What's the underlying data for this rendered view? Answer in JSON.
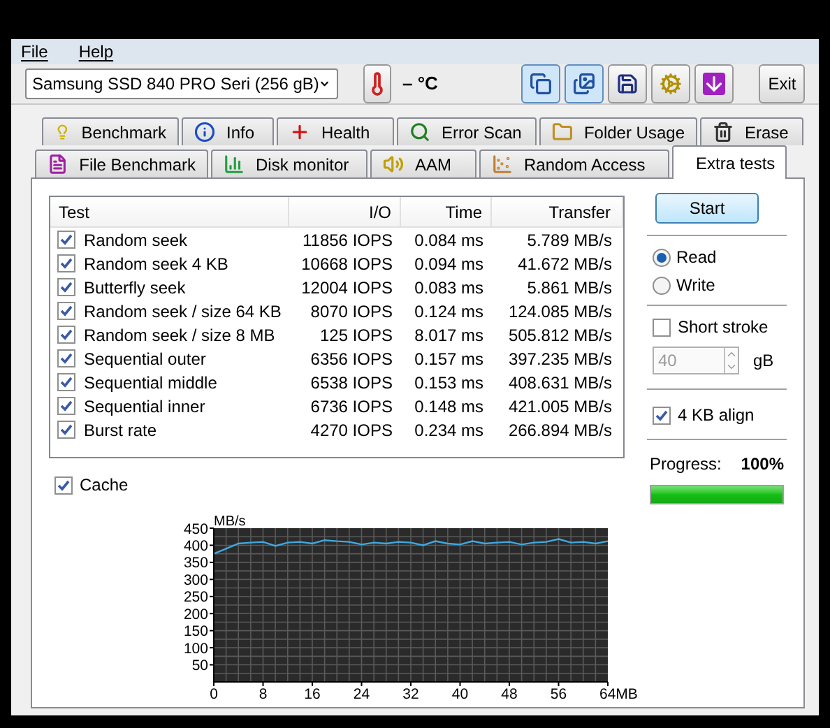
{
  "menu": [
    {
      "label": "File"
    },
    {
      "label": "Help"
    }
  ],
  "toolbar": {
    "drive": "Samsung SSD 840 PRO Seri (256 gB)",
    "temperature": "– °C",
    "tools": [
      {
        "pressed": true
      },
      {
        "pressed": true
      },
      {
        "pressed": false
      },
      {
        "pressed": false
      },
      {
        "pressed": false
      }
    ],
    "exit": "Exit"
  },
  "tabs_row_1": [
    {
      "label": "Benchmark",
      "selected": false
    },
    {
      "label": "Info",
      "selected": false
    },
    {
      "label": "Health",
      "selected": false
    },
    {
      "label": "Error Scan",
      "selected": false
    },
    {
      "label": "Folder Usage",
      "selected": false
    },
    {
      "label": "Erase",
      "selected": false
    }
  ],
  "tabs_row_2": [
    {
      "label": "File Benchmark",
      "selected": false
    },
    {
      "label": "Disk monitor",
      "selected": false
    },
    {
      "label": "AAM",
      "selected": false
    },
    {
      "label": "Random Access",
      "selected": false
    },
    {
      "label": "Extra tests",
      "selected": true
    }
  ],
  "table": {
    "columns": [
      "Test",
      "I/O",
      "Time",
      "Transfer"
    ],
    "rows": [
      {
        "checked": true,
        "test": "Random seek",
        "io": "11856 IOPS",
        "time": "0.084 ms",
        "transfer": "5.789 MB/s"
      },
      {
        "checked": true,
        "test": "Random seek 4 KB",
        "io": "10668 IOPS",
        "time": "0.094 ms",
        "transfer": "41.672 MB/s"
      },
      {
        "checked": true,
        "test": "Butterfly seek",
        "io": "12004 IOPS",
        "time": "0.083 ms",
        "transfer": "5.861 MB/s"
      },
      {
        "checked": true,
        "test": "Random seek / size 64 KB",
        "io": "8070 IOPS",
        "time": "0.124 ms",
        "transfer": "124.085 MB/s"
      },
      {
        "checked": true,
        "test": "Random seek / size 8 MB",
        "io": "125 IOPS",
        "time": "8.017 ms",
        "transfer": "505.812 MB/s"
      },
      {
        "checked": true,
        "test": "Sequential outer",
        "io": "6356 IOPS",
        "time": "0.157 ms",
        "transfer": "397.235 MB/s"
      },
      {
        "checked": true,
        "test": "Sequential middle",
        "io": "6538 IOPS",
        "time": "0.153 ms",
        "transfer": "408.631 MB/s"
      },
      {
        "checked": true,
        "test": "Sequential inner",
        "io": "6736 IOPS",
        "time": "0.148 ms",
        "transfer": "421.005 MB/s"
      },
      {
        "checked": true,
        "test": "Burst rate",
        "io": "4270 IOPS",
        "time": "0.234 ms",
        "transfer": "266.894 MB/s"
      }
    ]
  },
  "cache": {
    "label": "Cache",
    "checked": true
  },
  "side": {
    "start": "Start",
    "modes": [
      {
        "label": "Read",
        "selected": true
      },
      {
        "label": "Write",
        "selected": false
      }
    ],
    "short_stroke": {
      "label": "Short stroke",
      "checked": false
    },
    "size": {
      "value": "40",
      "disabled": true,
      "unit": "gB"
    },
    "align": {
      "label": "4 KB align",
      "checked": true
    },
    "progress": {
      "label": "Progress:",
      "reading": "100%",
      "level": 1
    }
  },
  "chart_data": {
    "type": "line",
    "grid": true,
    "ylabel": "MB/s",
    "xlim": [
      0,
      64
    ],
    "ylim": [
      0,
      450
    ],
    "xticks": [
      0,
      8,
      16,
      24,
      32,
      40,
      48,
      56,
      {
        "value": 64,
        "label": "64MB"
      }
    ],
    "yticks": [
      50,
      100,
      150,
      200,
      250,
      300,
      350,
      400,
      450
    ],
    "x": [
      0,
      2,
      4,
      6,
      8,
      10,
      12,
      14,
      16,
      18,
      20,
      22,
      24,
      26,
      28,
      30,
      32,
      34,
      36,
      38,
      40,
      42,
      44,
      46,
      48,
      50,
      52,
      54,
      56,
      58,
      60,
      62,
      64
    ],
    "series": [
      {
        "color": "#3fa9e0",
        "values": [
          375,
          390,
          405,
          408,
          410,
          398,
          408,
          410,
          405,
          415,
          412,
          410,
          402,
          408,
          405,
          410,
          408,
          400,
          412,
          405,
          402,
          412,
          405,
          408,
          410,
          402,
          408,
          410,
          418,
          408,
          410,
          405,
          412
        ]
      }
    ]
  }
}
